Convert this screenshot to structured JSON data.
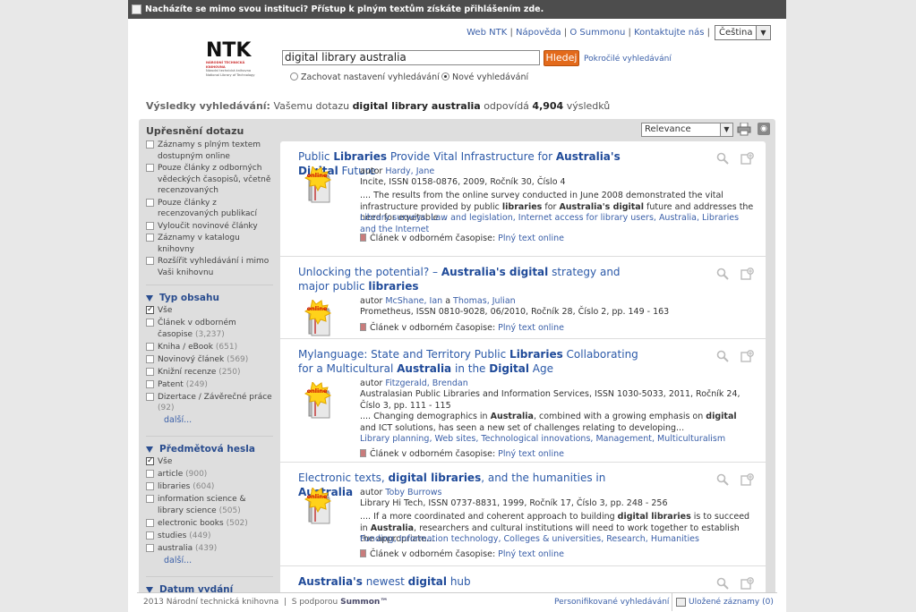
{
  "topbar": {
    "text": "Nacházíte se mimo svou instituci? Přístup k plným textům získáte přihlášením zde."
  },
  "header": {
    "links": [
      "Web NTK",
      "Nápověda",
      "O Summonu",
      "Kontaktujte nás"
    ],
    "language": "Čeština",
    "logo": {
      "name": "NTK",
      "line1": "NÁRODNÍ TECHNICKÁ KNIHOVNA",
      "line2": "Národní technická knihovna",
      "line3": "National Library of Technology"
    }
  },
  "search": {
    "value": "digital library australia",
    "button": "Hledej",
    "advanced": "Pokročilé vyhledávání",
    "options": [
      {
        "label": "Zachovat nastavení vyhledávání",
        "selected": false
      },
      {
        "label": "Nové vyhledávání",
        "selected": true
      }
    ]
  },
  "summary": {
    "label": "Výsledky vyhledávání:",
    "prefix": "Vašemu dotazu",
    "query": "digital library australia",
    "middle": "odpovídá",
    "count": "4,904",
    "suffix": "výsledků"
  },
  "refine": {
    "title": "Upřesnění dotazu",
    "options": [
      "Záznamy s plným textem dostupným online",
      "Pouze články z odborných vědeckých časopisů, včetně recenzovaných",
      "Pouze články z recenzovaných publikací",
      "Vyloučit novinové články",
      "Záznamy v katalogu knihovny",
      "Rozšířit vyhledávání i mimo Vaši knihovnu"
    ],
    "content_type": {
      "title": "Typ obsahu",
      "items": [
        {
          "label": "Vše",
          "count": "",
          "checked": true
        },
        {
          "label": "Článek v odborném časopise",
          "count": "(3,237)",
          "checked": false
        },
        {
          "label": "Kniha / eBook",
          "count": "(651)",
          "checked": false
        },
        {
          "label": "Novinový článek",
          "count": "(569)",
          "checked": false
        },
        {
          "label": "Knižní recenze",
          "count": "(250)",
          "checked": false
        },
        {
          "label": "Patent",
          "count": "(249)",
          "checked": false
        },
        {
          "label": "Dizertace / Závěrečné práce",
          "count": "(92)",
          "checked": false
        }
      ],
      "more": "další..."
    },
    "subjects": {
      "title": "Předmětová hesla",
      "items": [
        {
          "label": "Vše",
          "count": "",
          "checked": true
        },
        {
          "label": "article",
          "count": "(900)",
          "checked": false
        },
        {
          "label": "libraries",
          "count": "(604)",
          "checked": false
        },
        {
          "label": "information science & library science",
          "count": "(505)",
          "checked": false
        },
        {
          "label": "electronic books",
          "count": "(502)",
          "checked": false
        },
        {
          "label": "studies",
          "count": "(449)",
          "checked": false
        },
        {
          "label": "australia",
          "count": "(439)",
          "checked": false
        }
      ],
      "more": "další..."
    },
    "date": {
      "title": "Datum vydání"
    }
  },
  "sort": {
    "value": "Relevance"
  },
  "results": [
    {
      "title_parts": [
        [
          "Public ",
          0
        ],
        [
          "Libraries",
          1
        ],
        [
          " Provide Vital Infrastructure for ",
          0
        ],
        [
          "Australia's Digital",
          1
        ],
        [
          " Future",
          0
        ]
      ],
      "badge": "online",
      "author_label": "autor",
      "authors": [
        "Hardy, Jane"
      ],
      "source": "Incite, ISSN 0158-0876, 2009, Ročník 30, Číslo 4",
      "snippet_parts": [
        [
          ".... The results from the online survey conducted in June 2008 demonstrated the vital infrastructure provided by public ",
          0
        ],
        [
          "libraries",
          1
        ],
        [
          " for ",
          0
        ],
        [
          "Australia's digital",
          1
        ],
        [
          " future and addresses the need for equitable...",
          0
        ]
      ],
      "subjects": "Library surveys, Law and legislation, Internet access for library users, Australia, Libraries and the Internet",
      "format": "Článek v odborném časopise:",
      "fulltext": "Plný text online"
    },
    {
      "title_parts": [
        [
          "Unlocking the potential? – ",
          0
        ],
        [
          "Australia's digital",
          1
        ],
        [
          " strategy and major public ",
          0
        ],
        [
          "libraries",
          1
        ]
      ],
      "badge": "online",
      "author_label": "autor",
      "authors": [
        "McShane, Ian",
        "Thomas, Julian"
      ],
      "source": "Prometheus, ISSN 0810-9028, 06/2010, Ročník 28, Číslo 2, pp. 149 - 163",
      "snippet_parts": [],
      "subjects": "",
      "format": "Článek v odborném časopise:",
      "fulltext": "Plný text online"
    },
    {
      "title_parts": [
        [
          "Mylanguage: State and Territory Public ",
          0
        ],
        [
          "Libraries",
          1
        ],
        [
          " Collaborating for a Multicultural ",
          0
        ],
        [
          "Australia",
          1
        ],
        [
          " in the ",
          0
        ],
        [
          "Digital",
          1
        ],
        [
          " Age",
          0
        ]
      ],
      "badge": "online",
      "author_label": "autor",
      "authors": [
        "Fitzgerald, Brendan"
      ],
      "source": "Australasian Public Libraries and Information Services, ISSN 1030-5033, 2011, Ročník 24, Číslo 3, pp. 111 - 115",
      "snippet_parts": [
        [
          ".... Changing demographics in ",
          0
        ],
        [
          "Australia",
          1
        ],
        [
          ", combined with a growing emphasis on ",
          0
        ],
        [
          "digital",
          1
        ],
        [
          " and ICT solutions, has seen a new set of challenges relating to developing...",
          0
        ]
      ],
      "subjects": "Library planning, Web sites, Technological innovations, Management, Multiculturalism",
      "format": "Článek v odborném časopise:",
      "fulltext": "Plný text online"
    },
    {
      "title_parts": [
        [
          "Electronic texts, ",
          0
        ],
        [
          "digital libraries",
          1
        ],
        [
          ", and the humanities in ",
          0
        ],
        [
          "Australia",
          1
        ]
      ],
      "badge": "online",
      "author_label": "autor",
      "authors": [
        "Toby Burrows"
      ],
      "source": "Library Hi Tech, ISSN 0737-8831, 1999, Ročník 17, Číslo 3, pp. 248 - 256",
      "snippet_parts": [
        [
          ".... If a more coordinated and coherent approach to building ",
          0
        ],
        [
          "digital libraries",
          1
        ],
        [
          " is to succeed in ",
          0
        ],
        [
          "Australia",
          1
        ],
        [
          ", researchers and cultural institutions will need to work together to establish the appropriate...",
          0
        ]
      ],
      "subjects": "Funding, Information technology, Colleges & universities, Research, Humanities",
      "format": "Článek v odborném časopise:",
      "fulltext": "Plný text online"
    },
    {
      "title_parts": [
        [
          "Australia's",
          1
        ],
        [
          " newest ",
          0
        ],
        [
          "digital",
          1
        ],
        [
          " hub",
          0
        ]
      ],
      "badge": "",
      "author_label": "",
      "authors": [],
      "source": "",
      "snippet_parts": [],
      "subjects": "",
      "format": "",
      "fulltext": ""
    }
  ],
  "footer": {
    "copyright": "2013 Národní technická knihovna",
    "powered": "S podporou",
    "summon": "Summon™",
    "personal": "Personifikované vyhledávání",
    "saved": "Uložené záznamy (0)"
  }
}
